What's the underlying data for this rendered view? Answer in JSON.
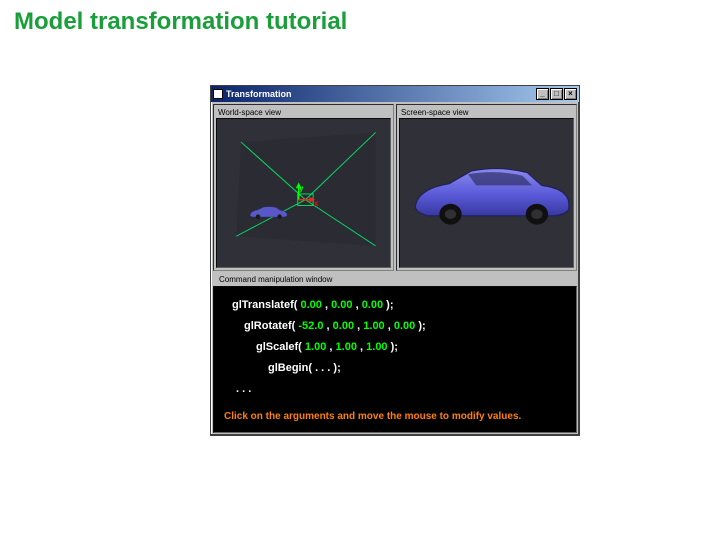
{
  "slide": {
    "title": "Model transformation tutorial"
  },
  "window": {
    "title": "Transformation",
    "minimize": "_",
    "maximize": "□",
    "close": "×"
  },
  "views": {
    "world_label": "World-space view",
    "screen_label": "Screen-space view",
    "axis_y": "y",
    "axis_x": "x"
  },
  "cmd": {
    "section_label": "Command manipulation window",
    "translate_fn": "glTranslatef(",
    "translate_a0": "0.00",
    "translate_a1": "0.00",
    "translate_a2": "0.00",
    "rotate_fn": "glRotatef(",
    "rotate_a0": "-52.0",
    "rotate_a1": "0.00",
    "rotate_a2": "1.00",
    "rotate_a3": "0.00",
    "scale_fn": "glScalef(",
    "scale_a0": "1.00",
    "scale_a1": "1.00",
    "scale_a2": "1.00",
    "begin_fn": "glBegin(",
    "begin_args": " . . . ",
    "close_paren": ");",
    "comma": " ,",
    "ellipsis": ". . .",
    "hint": "Click on the arguments and move the mouse to modify values."
  }
}
